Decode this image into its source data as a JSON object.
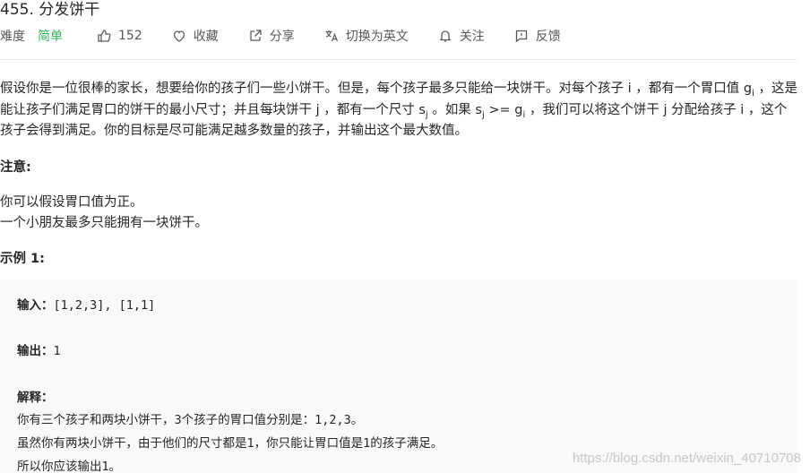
{
  "problem": {
    "title": "455. 分发饼干"
  },
  "meta": {
    "difficulty_label": "难度",
    "difficulty": "简单",
    "likes": "152",
    "favorite_label": "收藏",
    "share_label": "分享",
    "translate_label": "切换为英文",
    "follow_label": "关注",
    "feedback_label": "反馈"
  },
  "description": {
    "p1": "假设你是一位很棒的家长，想要给你的孩子们一些小饼干。但是，每个孩子最多只能给一块饼干。对每个孩子 i ，都有一个胃口值 g",
    "p1_sub_i": "i",
    "p2": " ，这是能让孩子们满足胃口的饼干的最小尺寸；并且每块饼干 j ，都有一个尺寸 s",
    "p2_sub_j": "j",
    "p3": " 。如果 s",
    "p3_sub_j": "j",
    "p4": " >= g",
    "p4_sub_i": "i",
    "p5": " ，我们可以将这个饼干 j 分配给孩子 i ，这个孩子会得到满足。你的目标是尽可能满足越多数量的孩子，并输出这个最大数值。"
  },
  "note": {
    "heading": "注意:",
    "line1": "你可以假设胃口值为正。",
    "line2": "一个小朋友最多只能拥有一块饼干。"
  },
  "example": {
    "heading": "示例 1:",
    "input_label": "输入：",
    "input_value": "[1,2,3], [1,1]",
    "output_label": "输出：",
    "output_value": "1",
    "explain_label": "解释：",
    "explain1": "你有三个孩子和两块小饼干，3个孩子的胃口值分别是：1,2,3。",
    "explain2": "虽然你有两块小饼干，由于他们的尺寸都是1，你只能让胃口值是1的孩子满足。",
    "explain3": "所以你应该输出1。"
  },
  "watermark": "https://blog.csdn.net/weixin_40710708",
  "colors": {
    "easy": "#2db55d",
    "text": "#262626",
    "meta": "#595959",
    "example_bg": "#f7f9fa"
  }
}
